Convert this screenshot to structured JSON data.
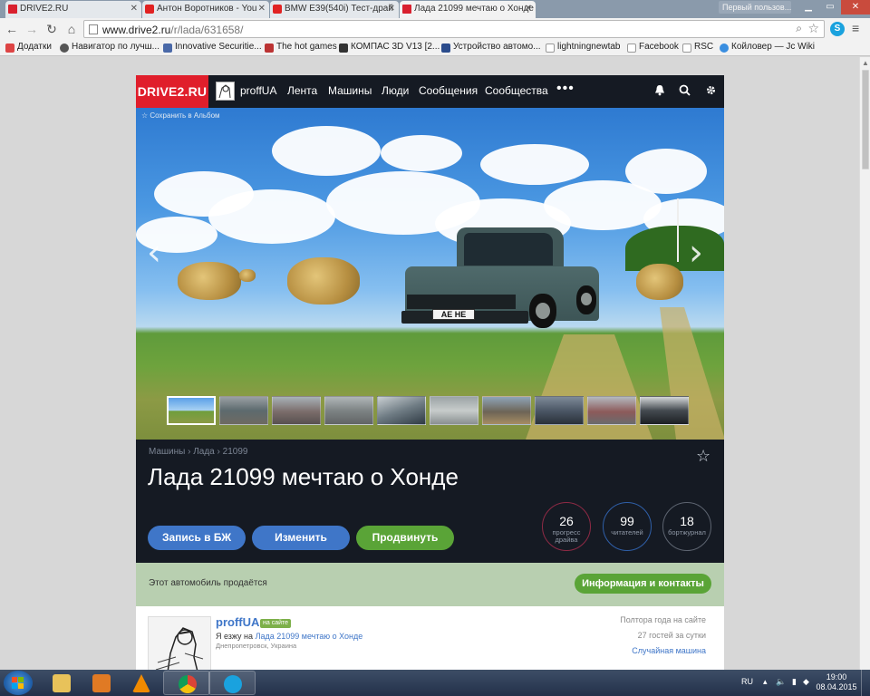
{
  "browser": {
    "tabs": [
      {
        "title": "DRIVE2.RU",
        "icon": "drive-icon"
      },
      {
        "title": "Антон Воротников - You",
        "icon": "youtube-icon"
      },
      {
        "title": "BMW E39(540i) Тест-драй",
        "icon": "youtube-icon"
      },
      {
        "title": "Лада 21099 мечтаю о Хонде",
        "icon": "drive-icon"
      }
    ],
    "profile": "Первый пользов...",
    "url_host": "www.drive2.ru",
    "url_path": "/r/lada/631658/",
    "bookmarks": [
      "Додатки",
      "Навигатор по лучш...",
      "Innovative Securitie...",
      "The hot games",
      "КОМПАС 3D V13 [2...",
      "Устройство автомо...",
      "lightningnewtab",
      "Facebook",
      "RSC",
      "Койловер — Jc Wiki"
    ]
  },
  "site": {
    "logo": "DRIVE2.RU",
    "user": "proffUA",
    "nav": [
      "Лента",
      "Машины",
      "Люди",
      "Сообщения",
      "Сообщества"
    ],
    "more": "•••"
  },
  "hero": {
    "save_album": "Сохранить в Альбом",
    "plate": "AE    HE",
    "thumb_count": 10
  },
  "car": {
    "breadcrumb": [
      "Машины",
      "Лада",
      "21099"
    ],
    "title": "Лада 21099 мечтаю о Хонде",
    "buttons": {
      "journal": "Запись в БЖ",
      "edit": "Изменить",
      "promote": "Продвинуть"
    },
    "stats": [
      {
        "value": "26",
        "label_1": "прогресс",
        "label_2": "драйва",
        "color": "#8e2a45"
      },
      {
        "value": "99",
        "label_1": "читателей",
        "label_2": "",
        "color": "#2f5fa8"
      },
      {
        "value": "18",
        "label_1": "бортжурнал",
        "label_2": "",
        "color": "#5d6470"
      }
    ]
  },
  "sale": {
    "text": "Этот автомобиль продаётся",
    "button": "Информация и контакты"
  },
  "owner": {
    "name": "proffUA",
    "badge": "на сайте",
    "line_prefix": "Я езжу на",
    "line_link": "Лада 21099 мечтаю о Хонде",
    "city": "Днепропетровск, Украина",
    "since": "Полтора года на сайте",
    "guests": "27 гостей за сутки",
    "random": "Случайная машина"
  },
  "taskbar": {
    "lang": "RU",
    "time": "19:00",
    "date": "08.04.2015"
  },
  "colors": {
    "accent_red": "#e01e2b",
    "button_blue": "#3f76c8",
    "button_green": "#5aa437",
    "dark_panel": "#151a23"
  }
}
